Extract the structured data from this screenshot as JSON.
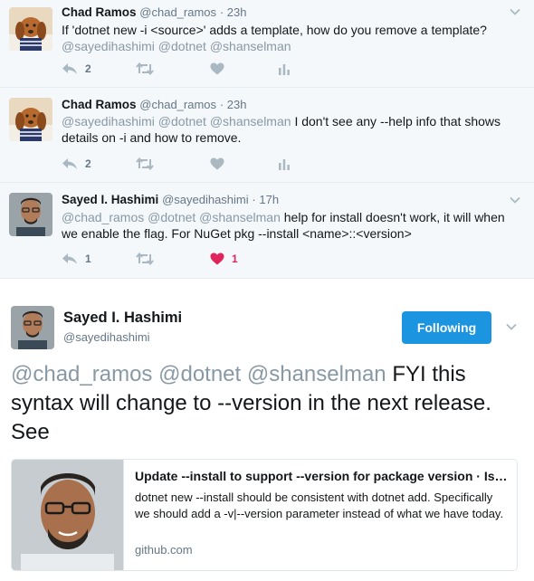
{
  "replies": [
    {
      "name": "Chad Ramos",
      "handle": "@chad_ramos",
      "time": "23h",
      "mentions": "",
      "text": "If 'dotnet new -i <source>' adds a template, how do you remove a template?",
      "text_after_mentions": "@sayedihashimi @dotnet @shanselman",
      "reply_count": "2",
      "like_count": "",
      "liked": false
    },
    {
      "name": "Chad Ramos",
      "handle": "@chad_ramos",
      "time": "23h",
      "mentions": "@sayedihashimi @dotnet @shanselman",
      "text": "I don't see any --help info that shows details on -i and how to remove.",
      "reply_count": "2",
      "like_count": "",
      "liked": false
    },
    {
      "name": "Sayed I. Hashimi",
      "handle": "@sayedihashimi",
      "time": "17h",
      "mentions": "@chad_ramos @dotnet @shanselman",
      "text": "help for install doesn't work, it will when we enable the flag. For NuGet pkg --install <name>::<version>",
      "reply_count": "1",
      "like_count": "1",
      "liked": true
    }
  ],
  "main_tweet": {
    "name": "Sayed I. Hashimi",
    "handle": "@sayedihashimi",
    "follow_label": "Following",
    "mentions": "@chad_ramos @dotnet @shanselman",
    "text": "FYI this syntax will change to --version in the next release. See"
  },
  "card": {
    "title": "Update --install to support --version for package version · Issue #...",
    "description": "dotnet new --install should be consistent with dotnet add. Specifically we should add a -v|--version parameter instead of what we have today.",
    "domain": "github.com"
  },
  "colors": {
    "accent": "#1b95e0",
    "like": "#e0245e",
    "mention": "#8899a6",
    "muted": "#657786",
    "reply_bg": "#f5f8fa"
  },
  "icons": [
    "reply-icon",
    "retweet-icon",
    "like-icon",
    "analytics-icon",
    "chevron-down-icon"
  ]
}
